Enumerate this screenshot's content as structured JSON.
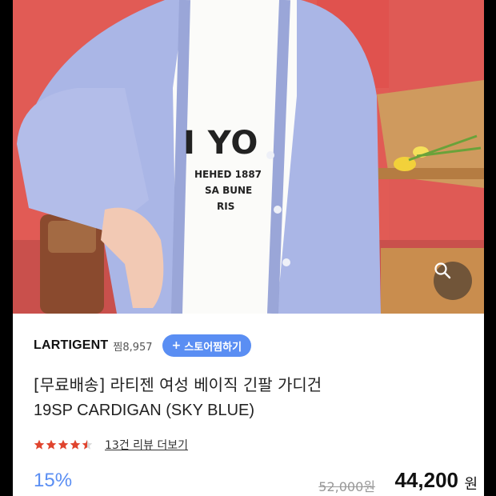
{
  "photo": {
    "shirt_print": {
      "big": "I YO",
      "line1": "HEHED 1887",
      "line2": "SA BUNE",
      "line3": "RIS"
    },
    "zoom_icon": "search-icon"
  },
  "store": {
    "name": "LARTIGENT",
    "jjim_count": "찜8,957",
    "follow_label": "스토어찜하기",
    "follow_icon": "plus-icon"
  },
  "product": {
    "title_line1": "[무료배송] 라티젠 여성 베이직 긴팔 가디건",
    "title_line2": "19SP CARDIGAN (SKY BLUE)"
  },
  "rating": {
    "stars": 4.5,
    "review_link": "13건 리뷰 더보기"
  },
  "price": {
    "discount": "15%",
    "original": "52,000원",
    "sale": "44,200",
    "currency": "원"
  },
  "colors": {
    "accent": "#5a8ef3",
    "star": "#e0442e",
    "cardigan": "#aab6e6"
  }
}
